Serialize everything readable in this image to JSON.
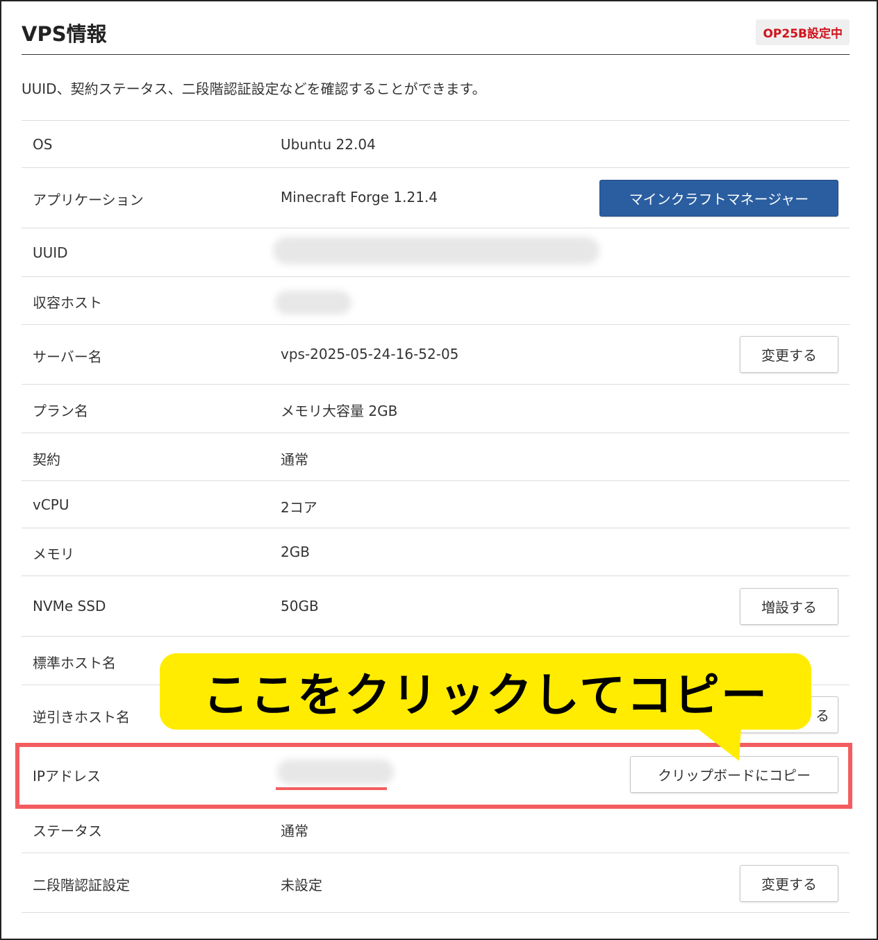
{
  "header": {
    "title": "VPS情報",
    "badge": "OP25B設定中"
  },
  "description": "UUID、契約ステータス、二段階認証設定などを確認することができます。",
  "rows": {
    "os": {
      "label": "OS",
      "value": "Ubuntu 22.04"
    },
    "app": {
      "label": "アプリケーション",
      "value": "Minecraft Forge 1.21.4",
      "button": "マインクラフトマネージャー"
    },
    "uuid": {
      "label": "UUID"
    },
    "host": {
      "label": "収容ホスト"
    },
    "server": {
      "label": "サーバー名",
      "value": "vps-2025-05-24-16-52-05",
      "button": "変更する"
    },
    "plan": {
      "label": "プラン名",
      "value": "メモリ大容量 2GB"
    },
    "contract": {
      "label": "契約",
      "value": "通常"
    },
    "vcpu": {
      "label": "vCPU",
      "value": "2コア"
    },
    "memory": {
      "label": "メモリ",
      "value": "2GB"
    },
    "ssd": {
      "label": "NVMe SSD",
      "value": "50GB",
      "button": "増設する"
    },
    "stdhost": {
      "label": "標準ホスト名"
    },
    "rdns": {
      "label": "逆引きホスト名",
      "button_visible": "る"
    },
    "ip": {
      "label": "IPアドレス",
      "button": "クリップボードにコピー"
    },
    "status": {
      "label": "ステータス",
      "value": "通常"
    },
    "twofa": {
      "label": "二段階認証設定",
      "value": "未設定",
      "button": "変更する"
    }
  },
  "callout": {
    "text": "ここをクリックしてコピー"
  },
  "colors": {
    "primary": "#2a5ea0",
    "badge_text": "#d0121b",
    "highlight": "#f25d5f",
    "callout": "#ffec00"
  }
}
